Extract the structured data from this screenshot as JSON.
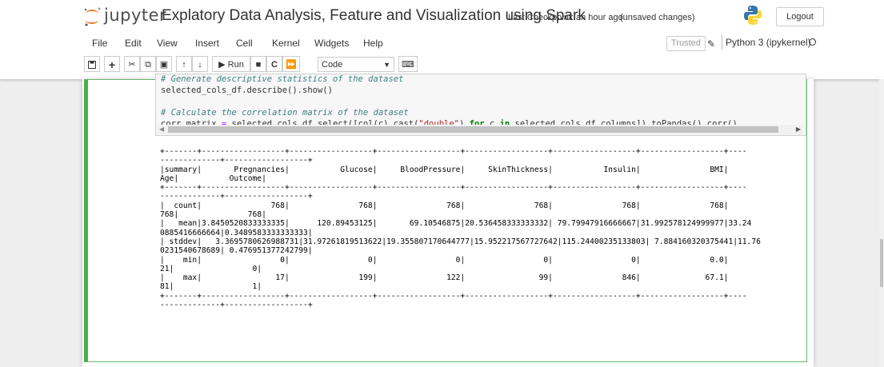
{
  "header": {
    "logo_text": "jupyter",
    "notebook_name": "Explatory Data Analysis, Feature and Visualization using Spark",
    "checkpoint": "Last Checkpoint: an hour ago",
    "unsaved": "(unsaved changes)",
    "logout_label": "Logout"
  },
  "menu": {
    "items": [
      "File",
      "Edit",
      "View",
      "Insert",
      "Cell",
      "Kernel",
      "Widgets",
      "Help"
    ],
    "trusted": "Trusted",
    "kernel": "Python 3 (ipykernel)"
  },
  "toolbar": {
    "run_label": "Run",
    "cell_type": "Code"
  },
  "cell": {
    "code": {
      "comment1": "# Generate descriptive statistics of the dataset",
      "line2": "selected_cols_df.describe().show()",
      "comment2": "# Calculate the correlation matrix of the dataset",
      "line4_a": "corr_matrix ",
      "line4_eq": "=",
      "line4_b": " selected_cols_df.select([col(c).cast(",
      "line4_str": "\"double\"",
      "line4_c": ") ",
      "line4_for": "for",
      "line4_d": " c ",
      "line4_in": "in",
      "line4_e": " selected_cols_df.columns]).toPandas().corr()"
    },
    "output_lines": [
      "+-------+------------------+------------------+------------------+------------------+------------------+------------------+----",
      "-------------+------------------+",
      "|summary|       Pregnancies|           Glucose|     BloodPressure|     SkinThickness|           Insulin|               BMI|",
      "Age|           Outcome|",
      "+-------+------------------+------------------+------------------+------------------+------------------+------------------+----",
      "-------------+------------------+",
      "|  count|               768|               768|               768|               768|               768|               768|",
      "768|               768|",
      "|   mean|3.8450520833333335|      120.89453125|       69.10546875|20.536458333333332| 79.79947916666667|31.992578124999977|33.24",
      "0885416666664|0.3489583333333333|",
      "| stddev|   3.3695780626988731|31.97261819513622|19.355807170644777|15.952217567727642|115.24400235133803| 7.884160320375441|11.76",
      "0231540678689| 0.476951377242799|",
      "|    min|                 0|                 0|                 0|                 0|                 0|               0.0|",
      "21|                 0|",
      "|    max|                17|               199|               122|                99|               846|              67.1|",
      "81|                 1|",
      "+-------+------------------+------------------+------------------+------------------+------------------+------------------+----",
      "-------------+------------------+"
    ]
  },
  "colors": {
    "cell_border": "#4caf50",
    "comment": "#408080",
    "string": "#ba2121",
    "keyword": "#008000"
  }
}
